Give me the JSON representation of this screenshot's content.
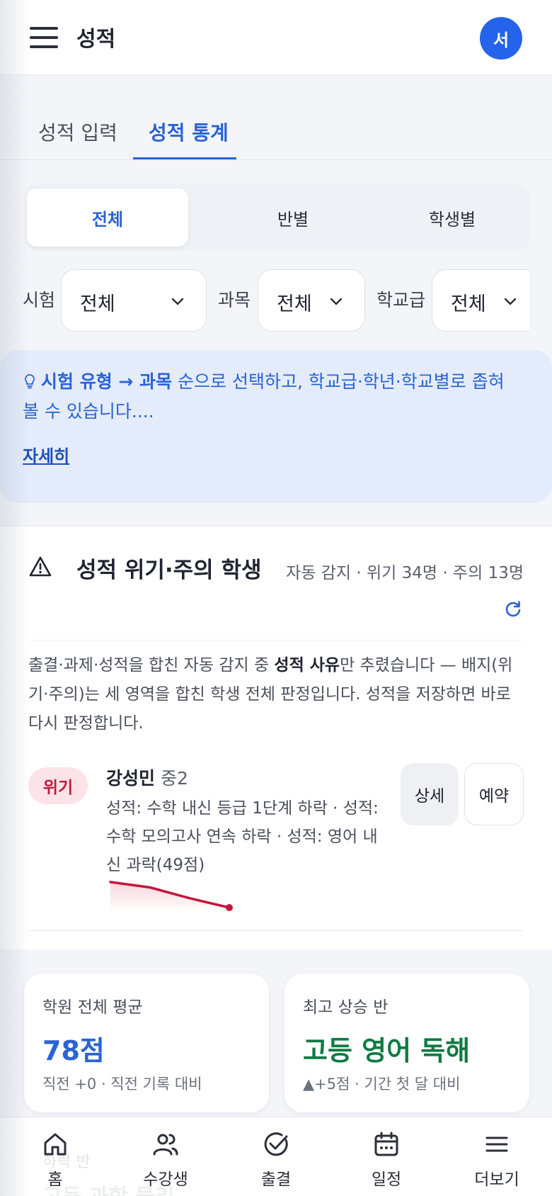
{
  "header": {
    "title": "성적",
    "avatar_initial": "서"
  },
  "tabs": [
    {
      "label": "성적 입력"
    },
    {
      "label": "성적 통계"
    }
  ],
  "segments": [
    {
      "label": "전체"
    },
    {
      "label": "반별"
    },
    {
      "label": "학생별"
    }
  ],
  "filters": {
    "exam": {
      "label": "시험",
      "value": "전체"
    },
    "subject": {
      "label": "과목",
      "value": "전체"
    },
    "school_level": {
      "label": "학교급",
      "value": "전체"
    }
  },
  "hint": {
    "part1": "시험 유형 → 과목",
    "part2": " 순으로 선택하고, 학교급·학년·학교별로 좁혀 볼 수 있습니다....",
    "more": "자세히"
  },
  "risk_card": {
    "title": "성적 위기·주의 학생",
    "subtitle": "자동 감지 · 위기 34명 · 주의 13명",
    "desc_pre": "출결·과제·성적을 합친 자동 감지 중 ",
    "desc_bold": "성적 사유",
    "desc_post": "만 추렸습니다 — 배지(위기·주의)는 세 영역을 합친 학생 전체 판정입니다. 성적을 저장하면 바로 다시 판정합니다.",
    "student": {
      "badge": "위기",
      "name": "강성민",
      "grade": "중2",
      "detail": "성적: 수학 내신 등급 1단계 하락 · 성적: 수학 모의고사 연속 하락 · 성적: 영어 내신 과락(49점)",
      "trend": [
        0.95,
        0.75,
        0.35,
        0.0
      ],
      "detail_button": "상세",
      "book_button": "예약"
    }
  },
  "stats": [
    {
      "label": "학원 전체 평균",
      "value": "78점",
      "note": "직전 +0 · 직전 기록 대비",
      "color": "#2a63d4"
    },
    {
      "label": "최고 상승 반",
      "value": "고등 영어 독해",
      "note": "▲+5점 · 기간 첫 달 대비",
      "color": "#0f7a43"
    }
  ],
  "behind_nav": {
    "label": "하락 반",
    "value": "고등 과학 물리"
  },
  "nav": [
    {
      "label": "홈",
      "icon": "home-icon"
    },
    {
      "label": "수강생",
      "icon": "users-icon"
    },
    {
      "label": "출결",
      "icon": "check-circle-icon"
    },
    {
      "label": "일정",
      "icon": "calendar-icon"
    },
    {
      "label": "더보기",
      "icon": "menu-icon"
    }
  ],
  "colors": {
    "accent": "#2a63d4",
    "danger": "#c2193c",
    "success": "#0f7a43"
  }
}
